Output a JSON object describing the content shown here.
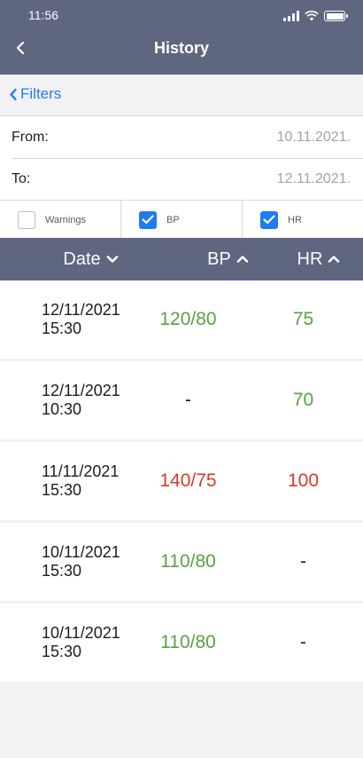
{
  "status": {
    "time": "11:56"
  },
  "header": {
    "title": "History"
  },
  "filters": {
    "link_label": "Filters",
    "from_label": "From:",
    "from_value": "10.11.2021.",
    "to_label": "To:",
    "to_value": "12.11.2021.",
    "checkboxes": [
      {
        "label": "Warnings",
        "checked": false
      },
      {
        "label": "BP",
        "checked": true
      },
      {
        "label": "HR",
        "checked": true
      }
    ]
  },
  "table": {
    "columns": [
      {
        "label": "Date",
        "sort": "chevron-down-icon"
      },
      {
        "label": "BP",
        "sort": "chevron-up-icon"
      },
      {
        "label": "HR",
        "sort": "chevron-up-icon"
      }
    ],
    "rows": [
      {
        "date": "12/11/2021",
        "time": "15:30",
        "bp": "120/80",
        "bp_status": "ok",
        "hr": "75",
        "hr_status": "ok"
      },
      {
        "date": "12/11/2021",
        "time": "10:30",
        "bp": "-",
        "bp_status": "neutral",
        "hr": "70",
        "hr_status": "ok"
      },
      {
        "date": "11/11/2021",
        "time": "15:30",
        "bp": "140/75",
        "bp_status": "warn",
        "hr": "100",
        "hr_status": "warn"
      },
      {
        "date": "10/11/2021",
        "time": "15:30",
        "bp": "110/80",
        "bp_status": "ok",
        "hr": "-",
        "hr_status": "neutral"
      },
      {
        "date": "10/11/2021",
        "time": "15:30",
        "bp": "110/80",
        "bp_status": "ok",
        "hr": "-",
        "hr_status": "neutral"
      }
    ]
  },
  "colors": {
    "header_bg": "#5f6680",
    "accent": "#1e7cf2",
    "ok": "#5ba041",
    "warn": "#d63a2a"
  }
}
